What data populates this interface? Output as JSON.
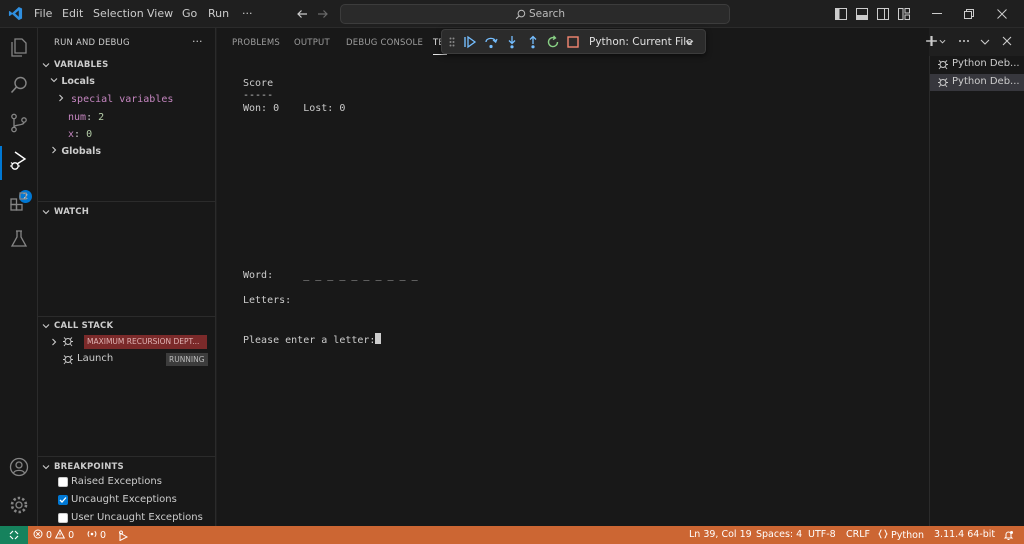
{
  "menu": [
    "File",
    "Edit",
    "Selection",
    "View",
    "Go",
    "Run",
    "···"
  ],
  "search": {
    "label": "Search"
  },
  "activity": {
    "run_badge": "2"
  },
  "sidebar": {
    "title": "RUN AND DEBUG",
    "more": "···",
    "variables": {
      "title": "VARIABLES",
      "locals_label": "Locals",
      "special": "special variables",
      "vars": [
        {
          "name": "num",
          "value": "2"
        },
        {
          "name": "x",
          "value": "0"
        }
      ],
      "globals_label": "Globals"
    },
    "watch": {
      "title": "WATCH"
    },
    "callstack": {
      "title": "CALL STACK",
      "items": [
        {
          "label": "",
          "badge": "MAXIMUM RECURSION DEPT..."
        },
        {
          "label": "Launch",
          "badge": "RUNNING"
        }
      ]
    },
    "breakpoints": {
      "title": "BREAKPOINTS",
      "items": [
        {
          "label": "Raised Exceptions",
          "checked": false
        },
        {
          "label": "Uncaught Exceptions",
          "checked": true
        },
        {
          "label": "User Uncaught Exceptions",
          "checked": false
        }
      ]
    }
  },
  "panel": {
    "tabs": [
      "PROBLEMS",
      "OUTPUT",
      "DEBUG CONSOLE",
      "TE"
    ]
  },
  "debug_toolbar": {
    "config": "Python: Current File"
  },
  "terminal": {
    "lines": [
      "Score",
      "-----",
      "Won: 0    Lost: 0",
      "Word:     _ _ _ _ _ _ _ _ _ _",
      "Letters:",
      "Please enter a letter:"
    ]
  },
  "terminals": [
    "Python Deb...",
    "Python Deb..."
  ],
  "status": {
    "errors": "0",
    "warnings": "0",
    "ports": "0",
    "position": "Ln 39, Col 19",
    "spaces": "Spaces: 4",
    "encoding": "UTF-8",
    "eol": "CRLF",
    "language": "Python",
    "interpreter": "3.11.4 64-bit"
  },
  "colors": {
    "statusbar": "#cc6633",
    "accent": "#0078d4",
    "recursion_badge": "#7b2a2a"
  }
}
